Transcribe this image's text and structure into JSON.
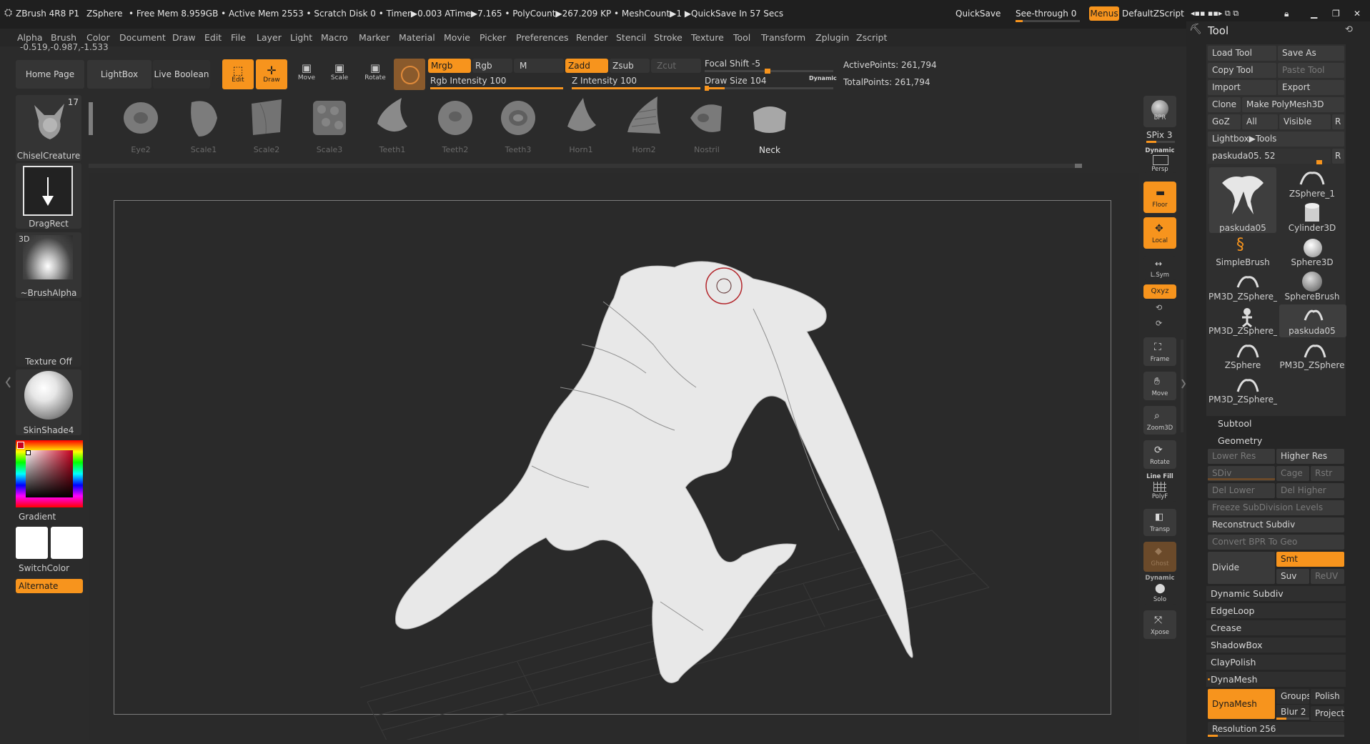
{
  "titlebar": {
    "app": "ZBrush 4R8 P1",
    "doc": "ZSphere",
    "stats": "• Free Mem 8.959GB • Active Mem 2553 • Scratch Disk 0 •  Timer▶0.003 ATime▶7.165 • PolyCount▶267.209 KP  • MeshCount▶1  ▶QuickSave In 57 Secs",
    "quicksave": "QuickSave",
    "seethrough": "See-through",
    "seethrough_value": "0",
    "menus": "Menus",
    "script": "DefaultZScript"
  },
  "menubar": [
    "Alpha",
    "Brush",
    "Color",
    "Document",
    "Draw",
    "Edit",
    "File",
    "Layer",
    "Light",
    "Macro",
    "Marker",
    "Material",
    "Movie",
    "Picker",
    "Preferences",
    "Render",
    "Stencil",
    "Stroke",
    "Texture",
    "Tool",
    "Transform",
    "Zplugin",
    "Zscript"
  ],
  "coords": "-0.519,-0.987,-1.533",
  "toolbar": {
    "home": "Home Page",
    "lightbox": "LightBox",
    "liveboolean": "Live Boolean",
    "edit": "Edit",
    "draw": "Draw",
    "move": "Move",
    "scale": "Scale",
    "rotate": "Rotate",
    "mrgb": "Mrgb",
    "rgb": "Rgb",
    "m": "M",
    "zadd": "Zadd",
    "zsub": "Zsub",
    "zcut": "Zcut",
    "rgb_intensity": "Rgb Intensity 100",
    "z_intensity": "Z Intensity 100",
    "focal_shift": "Focal Shift -5",
    "draw_size": "Draw Size 104",
    "dynamic": "Dynamic",
    "active_points": "ActivePoints: 261,794",
    "total_points": "TotalPoints: 261,794",
    "rgb_intensity_pct": 100,
    "z_intensity_pct": 100
  },
  "shelf": [
    "Eye2",
    "Scale1",
    "Scale2",
    "Scale3",
    "Teeth1",
    "Teeth2",
    "Teeth3",
    "Horn1",
    "Horn2",
    "Nostril",
    "Neck"
  ],
  "left": {
    "brush_count": "17",
    "brush": "ChiselCreature",
    "stroke": "DragRect",
    "alpha_tag": "3D",
    "alpha": "~BrushAlpha",
    "texture": "Texture Off",
    "material": "SkinShade4",
    "gradient": "Gradient",
    "switchcolor": "SwitchColor",
    "alternate": "Alternate"
  },
  "right_strip": {
    "bpr": "BPR",
    "spix": "SPix 3",
    "dynamic": "Dynamic",
    "persp": "Persp",
    "floor": "Floor",
    "local": "Local",
    "lsym": "L.Sym",
    "xyz": "Qxyz",
    "frame": "Frame",
    "move": "Move",
    "zoom": "Zoom3D",
    "rotate": "Rotate",
    "linefill": "Line Fill",
    "polyf": "PolyF",
    "transp": "Transp",
    "ghost": "Ghost",
    "solo_dynamic": "Dynamic",
    "solo": "Solo",
    "xpose": "Xpose"
  },
  "tool_panel": {
    "title": "Tool",
    "load": "Load Tool",
    "saveas": "Save As",
    "copy": "Copy Tool",
    "paste": "Paste Tool",
    "import": "Import",
    "export": "Export",
    "clone": "Clone",
    "makepoly": "Make PolyMesh3D",
    "goz": "GoZ",
    "all": "All",
    "visible": "Visible",
    "r": "R",
    "lightbox_tools": "Lightbox▶Tools",
    "current": "paskuda05. 52",
    "subtools": [
      "paskuda05",
      "ZSphere_1",
      "Cylinder3D",
      "SimpleBrush",
      "Sphere3D",
      "PM3D_ZSphere_",
      "SphereBrush",
      "PM3D_ZSphere_",
      "paskuda05",
      "ZSphere",
      "PM3D_ZSphere",
      "PM3D_ZSphere_"
    ],
    "subtool": "Subtool",
    "geometry": "Geometry",
    "lower_res": "Lower Res",
    "higher_res": "Higher Res",
    "sdiv": "SDiv",
    "cage": "Cage",
    "rstr": "Rstr",
    "del_lower": "Del Lower",
    "del_higher": "Del Higher",
    "freeze": "Freeze SubDivision Levels",
    "reconstruct": "Reconstruct Subdiv",
    "convert_bpr": "Convert BPR To Geo",
    "divide": "Divide",
    "smt": "Smt",
    "suv": "Suv",
    "reuv": "ReUV",
    "dynamic_subdiv": "Dynamic Subdiv",
    "edgeloop": "EdgeLoop",
    "crease": "Crease",
    "shadowbox": "ShadowBox",
    "claypolish": "ClayPolish",
    "dynamesh_section": "DynaMesh",
    "dynamesh": "DynaMesh",
    "groups": "Groups",
    "polish": "Polish",
    "blur": "Blur 2",
    "project": "Project",
    "resolution": "Resolution 256"
  }
}
